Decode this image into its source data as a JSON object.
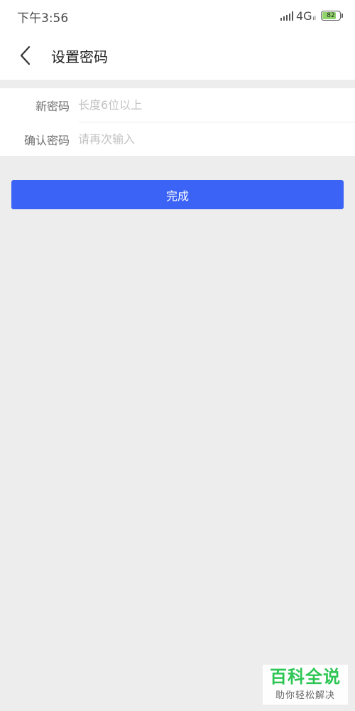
{
  "status_bar": {
    "time": "下午3:56",
    "network": "4G",
    "network_sub": "ıl",
    "battery": "82",
    "battery_level": 0.82
  },
  "header": {
    "title": "设置密码",
    "back_icon": "chevron-left-icon"
  },
  "form": {
    "new_password": {
      "label": "新密码",
      "placeholder": "长度6位以上",
      "value": ""
    },
    "confirm_password": {
      "label": "确认密码",
      "placeholder": "请再次输入",
      "value": ""
    }
  },
  "actions": {
    "submit_label": "完成"
  },
  "watermark": {
    "main": "百科全说",
    "sub": "助你轻松解决"
  },
  "colors": {
    "accent": "#3b63f6",
    "background": "#ededed",
    "watermark_green": "#2dc653"
  }
}
